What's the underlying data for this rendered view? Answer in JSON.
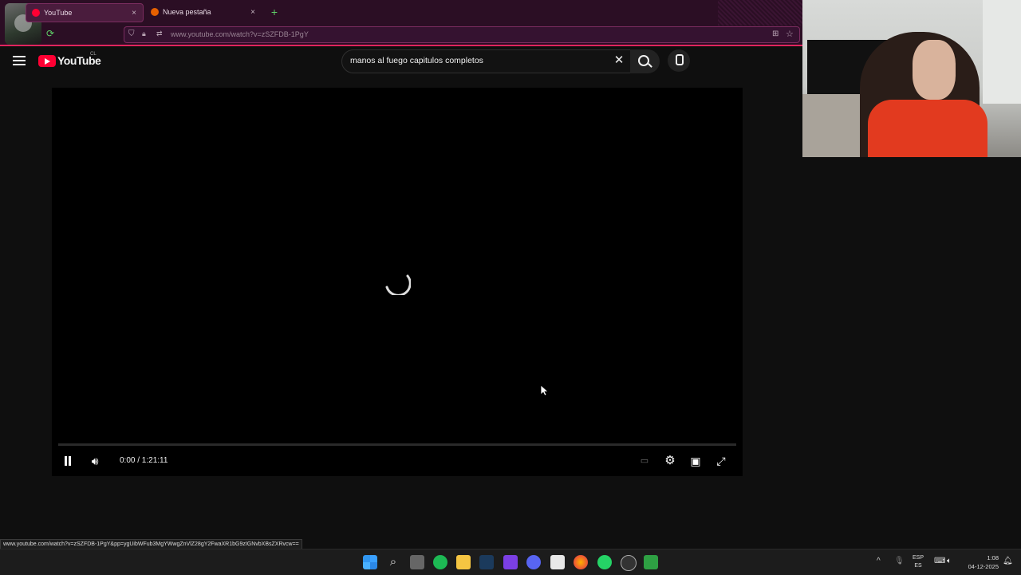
{
  "browser": {
    "tabs": [
      {
        "label": "YouTube",
        "close": "×"
      },
      {
        "label": "Nueva pestaña",
        "close": "×"
      }
    ],
    "new_tab": "+",
    "url": "www.youtube.com/watch?v=zSZFDB-1PgY",
    "status_link": "www.youtube.com/watch?v=zSZFDB-1PgY&pp=ygUibWFub3MgYWwgZnVlZ28gY2FwaXR1bG9zIGNvbXBsZXRvcw=="
  },
  "youtube": {
    "logo_text": "YouTube",
    "country": "CL",
    "search_query": "manos al fuego capitulos completos"
  },
  "player": {
    "time": "0:00 / 1:21:11",
    "progress": 0
  },
  "taskbar": {
    "apps": [
      "windows-start",
      "search",
      "task-view",
      "spotify",
      "file-explorer",
      "steam",
      "clipchamp",
      "discord",
      "stack-app",
      "firefox",
      "whatsapp",
      "obs",
      "app-green"
    ],
    "lang_top": "ESP",
    "lang_bottom": "ES",
    "time": "1:08",
    "date": "04-12-2025"
  },
  "colors": {
    "accent": "#ff0033",
    "chrome": "#2b0e24"
  }
}
